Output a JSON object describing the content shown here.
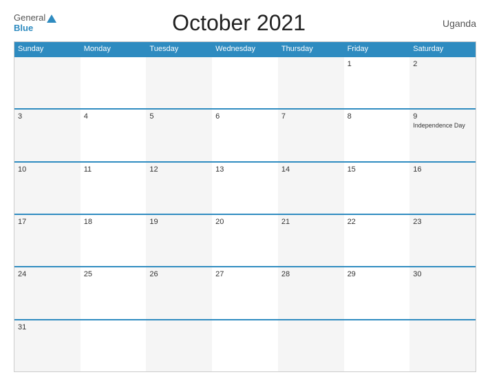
{
  "header": {
    "title": "October 2021",
    "country": "Uganda",
    "logo_general": "General",
    "logo_blue": "Blue"
  },
  "days_of_week": [
    "Sunday",
    "Monday",
    "Tuesday",
    "Wednesday",
    "Thursday",
    "Friday",
    "Saturday"
  ],
  "weeks": [
    [
      {
        "date": "",
        "event": ""
      },
      {
        "date": "",
        "event": ""
      },
      {
        "date": "",
        "event": ""
      },
      {
        "date": "",
        "event": ""
      },
      {
        "date": "",
        "event": ""
      },
      {
        "date": "1",
        "event": ""
      },
      {
        "date": "2",
        "event": ""
      }
    ],
    [
      {
        "date": "3",
        "event": ""
      },
      {
        "date": "4",
        "event": ""
      },
      {
        "date": "5",
        "event": ""
      },
      {
        "date": "6",
        "event": ""
      },
      {
        "date": "7",
        "event": ""
      },
      {
        "date": "8",
        "event": ""
      },
      {
        "date": "9",
        "event": "Independence Day"
      }
    ],
    [
      {
        "date": "10",
        "event": ""
      },
      {
        "date": "11",
        "event": ""
      },
      {
        "date": "12",
        "event": ""
      },
      {
        "date": "13",
        "event": ""
      },
      {
        "date": "14",
        "event": ""
      },
      {
        "date": "15",
        "event": ""
      },
      {
        "date": "16",
        "event": ""
      }
    ],
    [
      {
        "date": "17",
        "event": ""
      },
      {
        "date": "18",
        "event": ""
      },
      {
        "date": "19",
        "event": ""
      },
      {
        "date": "20",
        "event": ""
      },
      {
        "date": "21",
        "event": ""
      },
      {
        "date": "22",
        "event": ""
      },
      {
        "date": "23",
        "event": ""
      }
    ],
    [
      {
        "date": "24",
        "event": ""
      },
      {
        "date": "25",
        "event": ""
      },
      {
        "date": "26",
        "event": ""
      },
      {
        "date": "27",
        "event": ""
      },
      {
        "date": "28",
        "event": ""
      },
      {
        "date": "29",
        "event": ""
      },
      {
        "date": "30",
        "event": ""
      }
    ],
    [
      {
        "date": "31",
        "event": ""
      },
      {
        "date": "",
        "event": ""
      },
      {
        "date": "",
        "event": ""
      },
      {
        "date": "",
        "event": ""
      },
      {
        "date": "",
        "event": ""
      },
      {
        "date": "",
        "event": ""
      },
      {
        "date": "",
        "event": ""
      }
    ]
  ],
  "accent_color": "#2e8bc0",
  "alt_bg": "#f5f5f5"
}
